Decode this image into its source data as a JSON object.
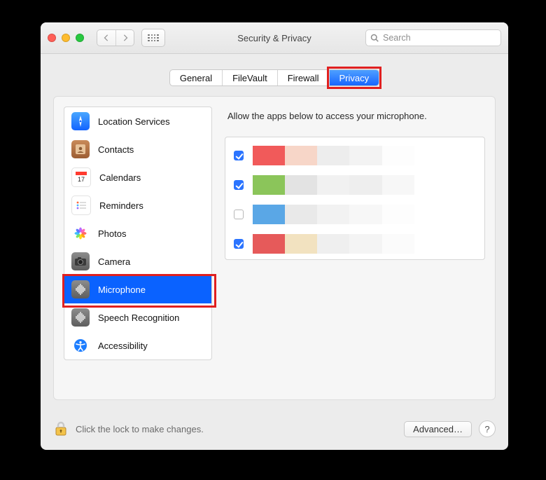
{
  "window": {
    "title": "Security & Privacy"
  },
  "search": {
    "placeholder": "Search"
  },
  "tabs": [
    {
      "id": "general",
      "label": "General",
      "active": false
    },
    {
      "id": "filevault",
      "label": "FileVault",
      "active": false
    },
    {
      "id": "firewall",
      "label": "Firewall",
      "active": false
    },
    {
      "id": "privacy",
      "label": "Privacy",
      "active": true,
      "highlighted": true
    }
  ],
  "sidebar": {
    "items": [
      {
        "id": "location-services",
        "label": "Location Services",
        "icon": "compass",
        "selected": false
      },
      {
        "id": "contacts",
        "label": "Contacts",
        "icon": "address-book",
        "selected": false
      },
      {
        "id": "calendars",
        "label": "Calendars",
        "icon": "calendar",
        "selected": false
      },
      {
        "id": "reminders",
        "label": "Reminders",
        "icon": "reminders",
        "selected": false
      },
      {
        "id": "photos",
        "label": "Photos",
        "icon": "photos-flower",
        "selected": false
      },
      {
        "id": "camera",
        "label": "Camera",
        "icon": "camera",
        "selected": false
      },
      {
        "id": "microphone",
        "label": "Microphone",
        "icon": "microphone-wave",
        "selected": true,
        "highlighted": true
      },
      {
        "id": "speech",
        "label": "Speech Recognition",
        "icon": "microphone-wave",
        "selected": false
      },
      {
        "id": "accessibility",
        "label": "Accessibility",
        "icon": "accessibility",
        "selected": false
      }
    ]
  },
  "right": {
    "description": "Allow the apps below to access your microphone.",
    "apps": [
      {
        "checked": true,
        "obscured": true,
        "palette": [
          "#f15a5a",
          "#f7d6c8",
          "#ededed",
          "#f3f3f3",
          "#fdfdfd",
          "#ffffff",
          "#ffffff"
        ]
      },
      {
        "checked": true,
        "obscured": true,
        "palette": [
          "#8bc55a",
          "#e3e3e3",
          "#f1f1f1",
          "#eeeeee",
          "#f7f7f7",
          "#ffffff",
          "#ffffff"
        ]
      },
      {
        "checked": false,
        "obscured": true,
        "palette": [
          "#5aa7e6",
          "#e9e9e9",
          "#f2f2f2",
          "#f7f7f7",
          "#fdfdfd",
          "#ffffff",
          "#ffffff"
        ]
      },
      {
        "checked": true,
        "obscured": true,
        "palette": [
          "#e65a5a",
          "#f2e2c0",
          "#efefef",
          "#f4f4f4",
          "#fbfbfb",
          "#ffffff",
          "#ffffff"
        ]
      }
    ]
  },
  "footer": {
    "lock_hint": "Click the lock to make changes.",
    "advanced_label": "Advanced…",
    "help_label": "?"
  }
}
